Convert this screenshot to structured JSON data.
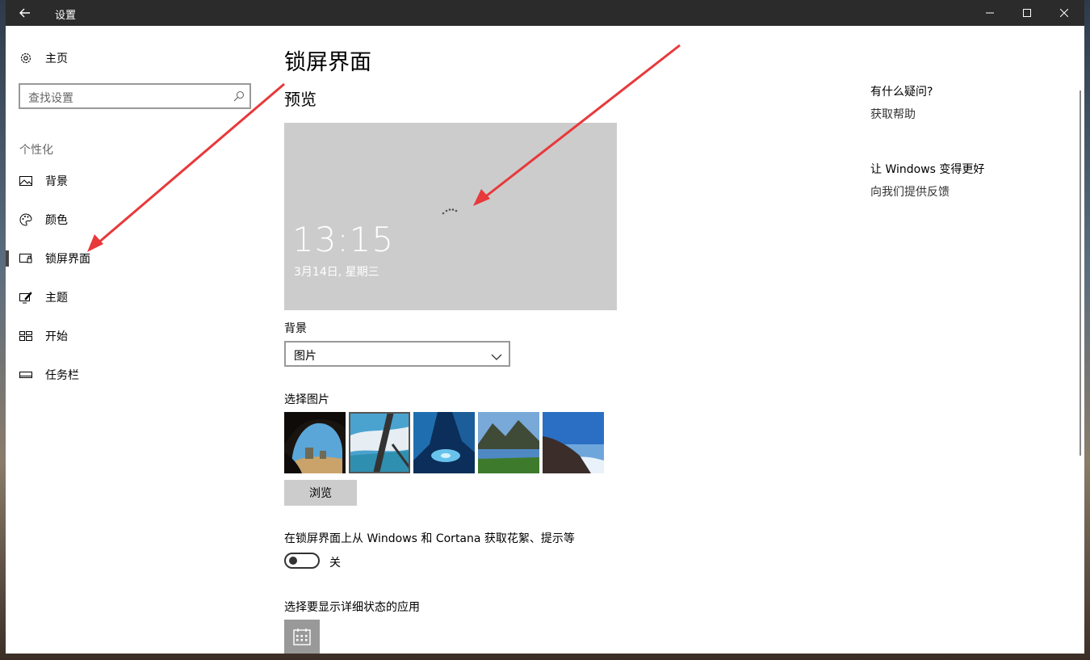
{
  "window": {
    "title": "设置",
    "controls": {
      "minimize": "minimize",
      "maximize": "maximize",
      "close": "close"
    }
  },
  "sidebar": {
    "home_label": "主页",
    "search_placeholder": "查找设置",
    "category": "个性化",
    "items": [
      {
        "label": "背景",
        "icon": "picture-icon"
      },
      {
        "label": "颜色",
        "icon": "palette-icon"
      },
      {
        "label": "锁屏界面",
        "icon": "lock-screen-icon",
        "selected": true
      },
      {
        "label": "主题",
        "icon": "theme-icon"
      },
      {
        "label": "开始",
        "icon": "start-icon"
      },
      {
        "label": "任务栏",
        "icon": "taskbar-icon"
      }
    ]
  },
  "main": {
    "title": "锁屏界面",
    "preview_heading": "预览",
    "preview": {
      "time": "13:15",
      "date": "3月14日, 星期三"
    },
    "background_label": "背景",
    "background_value": "图片",
    "choose_picture_label": "选择图片",
    "browse_label": "浏览",
    "spotlight_label": "在锁屏界面上从 Windows 和 Cortana 获取花絮、提示等",
    "toggle_state": "关",
    "detailed_status_label": "选择要显示详细状态的应用"
  },
  "right_panel": {
    "question_heading": "有什么疑问?",
    "help_link": "获取帮助",
    "feedback_heading": "让 Windows 变得更好",
    "feedback_link": "向我们提供反馈"
  },
  "colors": {
    "titlebar": "#2b2b2b",
    "preview_bg": "#cccccc",
    "annotation_arrow": "#e8393b"
  }
}
